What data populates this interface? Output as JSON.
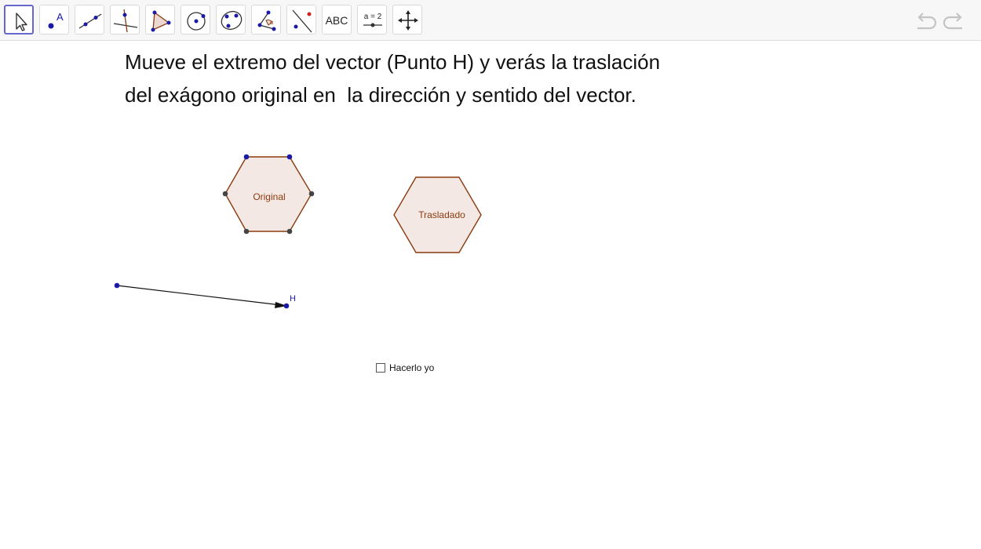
{
  "toolbar": {
    "tools": [
      {
        "id": "move",
        "icon": "move-arrow-icon",
        "selected": true
      },
      {
        "id": "point",
        "icon": "point-icon",
        "letter": "A"
      },
      {
        "id": "line",
        "icon": "line-icon"
      },
      {
        "id": "perpendicular",
        "icon": "perpendicular-line-icon"
      },
      {
        "id": "polygon",
        "icon": "polygon-icon"
      },
      {
        "id": "circle",
        "icon": "circle-center-point-icon"
      },
      {
        "id": "conic",
        "icon": "ellipse-icon"
      },
      {
        "id": "angle",
        "icon": "angle-icon",
        "angle_mark": "α"
      },
      {
        "id": "reflect",
        "icon": "reflect-line-icon"
      },
      {
        "id": "text",
        "icon": "text-icon",
        "label": "ABC"
      },
      {
        "id": "slider",
        "icon": "slider-icon",
        "label": "a = 2"
      },
      {
        "id": "move-view",
        "icon": "move-graphics-view-icon"
      }
    ],
    "undo_icon": "undo-icon",
    "redo_icon": "redo-icon"
  },
  "instruction": {
    "line1": "Mueve el extremo del vector (Punto H) y verás la traslación",
    "line2": "del exágono original en  la dirección y sentido del vector."
  },
  "construction": {
    "original_label": "Original",
    "translated_label": "Trasladado",
    "point_h_label": "H"
  },
  "checkbox": {
    "label": "Hacerlo yo",
    "checked": false
  },
  "colors": {
    "polygon_stroke": "#8b3a0e",
    "polygon_fill": "#f3e8e4",
    "free_point": "#1a1aa6",
    "dependent_point": "#444444",
    "vector": "#111111",
    "selected_tool_border": "#6666cc"
  }
}
